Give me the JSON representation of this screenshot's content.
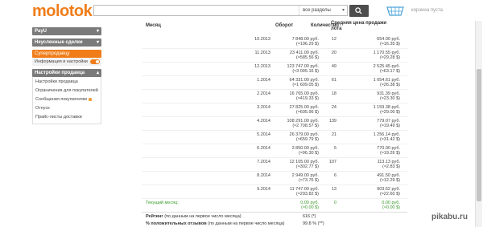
{
  "header": {
    "logo": "molotok",
    "search": {
      "placeholder": "",
      "category": "все разделы"
    },
    "cart": "корзина пуста"
  },
  "sidebar": {
    "sections": [
      {
        "label": "PayU"
      },
      {
        "label": "Неусленные сделки"
      }
    ],
    "superseller": "Суперпродавцу",
    "info_settings": "Информация и настройки",
    "seller_settings": "Настройки продавца",
    "items": [
      {
        "label": "Настройки продавца"
      },
      {
        "label": "Ограничения для покупателей"
      },
      {
        "label": "Сообщения покупателям"
      },
      {
        "label": "Отпуск"
      },
      {
        "label": "Прайс-листы доставки"
      }
    ]
  },
  "table": {
    "headers": {
      "month": "Месяц",
      "turnover": "Оборот",
      "count": "Количество",
      "avg_price_line1": "Средняя цена продажи",
      "avg_price_line2": "лота"
    },
    "rows": [
      {
        "month": "10.2013",
        "turnover": "7 848.00 руб.",
        "turnover_usd": "(≈196.29 $)",
        "count": "12",
        "avg": "654.00 руб.",
        "avg_usd": "(≈16.35 $)"
      },
      {
        "month": "11.2013",
        "turnover": "23 411.00 руб.",
        "turnover_usd": "(≈585.56 $)",
        "count": "20",
        "avg": "1 170.55 руб.",
        "avg_usd": "(≈29.28 $)"
      },
      {
        "month": "12.2013",
        "turnover": "123 747.00 руб.",
        "turnover_usd": "(≈3 095.16 $)",
        "count": "49",
        "avg": "2 525.45 руб.",
        "avg_usd": "(≈63.17 $)"
      },
      {
        "month": "1.2014",
        "turnover": "64 331.00 руб.",
        "turnover_usd": "(≈1 609.05 $)",
        "count": "61",
        "avg": "1 054.61 руб.",
        "avg_usd": "(≈26.38 $)"
      },
      {
        "month": "2.2014",
        "turnover": "16 765.00 руб.",
        "turnover_usd": "(≈419.33 $)",
        "count": "18",
        "avg": "931.39 руб.",
        "avg_usd": "(≈23.30 $)"
      },
      {
        "month": "3.2014",
        "turnover": "27 825.00 руб.",
        "turnover_usd": "(≈695.96 $)",
        "count": "24",
        "avg": "1 159.38 руб.",
        "avg_usd": "(≈29.00 $)"
      },
      {
        "month": "4.2014",
        "turnover": "108 291.00 руб.",
        "turnover_usd": "(≈2 708.57 $)",
        "count": "139",
        "avg": "779.07 руб.",
        "avg_usd": "(≈19.49 $)"
      },
      {
        "month": "5.2014",
        "turnover": "26 379.00 руб.",
        "turnover_usd": "(≈659.79 $)",
        "count": "21",
        "avg": "1 256.14 руб.",
        "avg_usd": "(≈31.42 $)"
      },
      {
        "month": "6.2014",
        "turnover": "3 850.00 руб.",
        "turnover_usd": "(≈96.30 $)",
        "count": "5",
        "avg": "770.00 руб.",
        "avg_usd": "(≈19.26 $)"
      },
      {
        "month": "7.2014",
        "turnover": "12 105.00 руб.",
        "turnover_usd": "(≈302.77 $)",
        "count": "107",
        "avg": "113.13 руб.",
        "avg_usd": "(≈2.83 $)"
      },
      {
        "month": "8.2014",
        "turnover": "2 949.00 руб.",
        "turnover_usd": "(≈73.76 $)",
        "count": "6",
        "avg": "491.50 руб.",
        "avg_usd": "(≈12.29 $)"
      },
      {
        "month": "9.2014",
        "turnover": "11 747.00 руб.",
        "turnover_usd": "(≈293.82 $)",
        "count": "13",
        "avg": "903.62 руб.",
        "avg_usd": "(≈22.60 $)"
      }
    ],
    "current": {
      "label": "Текущий месяц:",
      "turnover": "0.00 руб.",
      "turnover_usd": "(≈0.00 $)",
      "count": "0",
      "avg": "0.00 руб.",
      "avg_usd": "(≈0.00 $)"
    },
    "rating": {
      "label": "Рейтинг",
      "note": "(по данным на первое число месяца)",
      "value": "616 (*)"
    },
    "positive": {
      "label": "% положительных отзывов",
      "note": "(по данным на первое число месяца)",
      "value": "99.8 % (**)"
    }
  },
  "watermark": "pikabu.ru",
  "colors": {
    "brand": "#f07d1a",
    "green": "#3a9a2a",
    "sidebar_bar": "#7a7a7a"
  }
}
